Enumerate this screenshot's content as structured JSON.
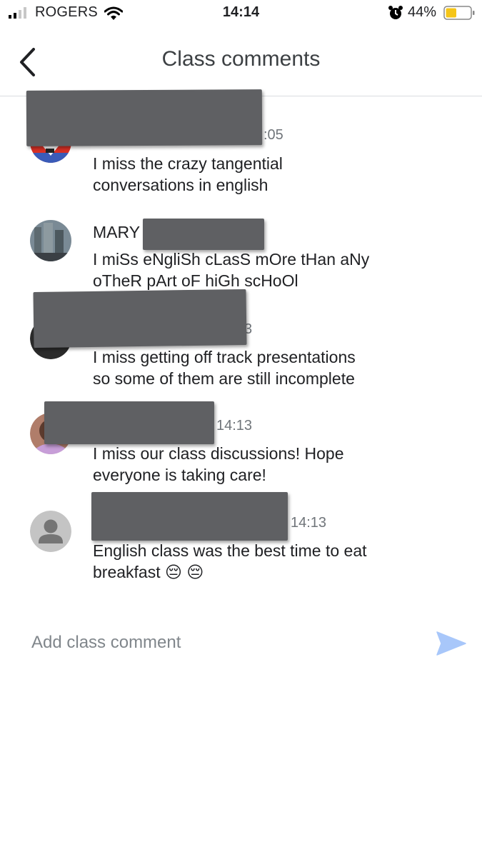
{
  "status_bar": {
    "carrier": "ROGERS",
    "time": "14:14",
    "battery": "44%",
    "battery_level": 0.44,
    "battery_color": "#f5c518",
    "icons": [
      "signal-icon",
      "wifi-icon",
      "alarm-clock-icon",
      "battery-icon"
    ]
  },
  "header": {
    "title": "Class comments",
    "back_icon": "chevron-left-icon"
  },
  "comments": [
    {
      "name": "",
      "time": ":05",
      "text_lines": [
        "I miss the crazy tangential",
        "conversations in english"
      ]
    },
    {
      "name": "MARY",
      "time": "",
      "text_lines": [
        "I miSs eNgliSh cLasS mOre tHan aNy",
        "oTheR pArt oF hiGh scHoOl"
      ]
    },
    {
      "name": "",
      "time": "3",
      "text_lines": [
        "I miss getting off track presentations",
        "so some of them are still incomplete"
      ]
    },
    {
      "name": "",
      "time": "14:13",
      "text_lines": [
        "I miss our class discussions! Hope",
        "everyone is taking care!"
      ]
    },
    {
      "name": "",
      "time": "14:13",
      "text_lines": [
        "English class was the best time to eat",
        "breakfast 😔 😔"
      ]
    }
  ],
  "compose": {
    "placeholder": "Add class comment",
    "send_icon": "send-icon",
    "send_color": "#a8c7fa"
  }
}
